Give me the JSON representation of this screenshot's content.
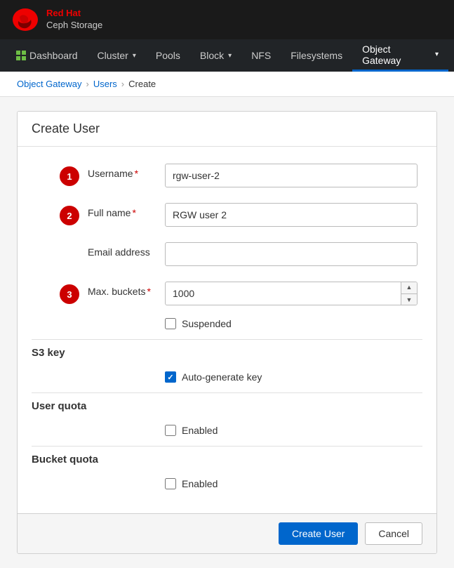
{
  "brand": {
    "line1": "Red Hat",
    "line2": "Ceph Storage"
  },
  "navbar": {
    "items": [
      {
        "id": "dashboard",
        "label": "Dashboard",
        "hasIcon": true,
        "hasDropdown": false,
        "active": false
      },
      {
        "id": "cluster",
        "label": "Cluster",
        "hasDropdown": true,
        "active": false
      },
      {
        "id": "pools",
        "label": "Pools",
        "hasDropdown": false,
        "active": false
      },
      {
        "id": "block",
        "label": "Block",
        "hasDropdown": true,
        "active": false
      },
      {
        "id": "nfs",
        "label": "NFS",
        "hasDropdown": false,
        "active": false
      },
      {
        "id": "filesystems",
        "label": "Filesystems",
        "hasDropdown": false,
        "active": false
      },
      {
        "id": "object-gateway",
        "label": "Object Gateway",
        "hasDropdown": true,
        "active": true
      }
    ]
  },
  "breadcrumb": {
    "items": [
      {
        "label": "Object Gateway",
        "link": true
      },
      {
        "label": "Users",
        "link": true
      },
      {
        "label": "Create",
        "link": false
      }
    ]
  },
  "form": {
    "title": "Create User",
    "fields": {
      "username": {
        "label": "Username",
        "required": true,
        "value": "rgw-user-2",
        "placeholder": "",
        "step": "1"
      },
      "fullname": {
        "label": "Full name",
        "required": true,
        "value": "RGW user 2",
        "placeholder": "",
        "step": "2"
      },
      "email": {
        "label": "Email address",
        "required": false,
        "value": "",
        "placeholder": ""
      },
      "maxBuckets": {
        "label": "Max. buckets",
        "required": true,
        "value": "1000",
        "step": "3"
      }
    },
    "suspended": {
      "label": "Suspended",
      "checked": false
    },
    "s3key": {
      "title": "S3 key",
      "autogenerate": {
        "label": "Auto-generate key",
        "checked": true
      }
    },
    "userQuota": {
      "title": "User quota",
      "enabled": {
        "label": "Enabled",
        "checked": false
      }
    },
    "bucketQuota": {
      "title": "Bucket quota",
      "enabled": {
        "label": "Enabled",
        "checked": false
      }
    }
  },
  "footer": {
    "createButton": "Create User",
    "cancelButton": "Cancel"
  }
}
